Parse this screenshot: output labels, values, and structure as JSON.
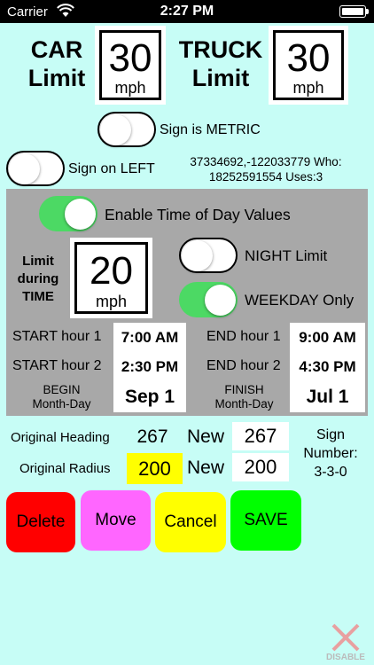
{
  "status_bar": {
    "carrier": "Carrier",
    "time": "2:27 PM"
  },
  "car": {
    "label_line1": "CAR",
    "label_line2": "Limit",
    "speed": "30",
    "unit": "mph"
  },
  "truck": {
    "label_line1": "TRUCK",
    "label_line2": "Limit",
    "speed": "30",
    "unit": "mph"
  },
  "toggles": {
    "metric": {
      "label": "Sign is METRIC",
      "on": false
    },
    "left": {
      "label": "Sign on LEFT",
      "on": false
    },
    "time_of_day": {
      "label": "Enable Time of Day Values",
      "on": true
    },
    "night": {
      "label": "NIGHT Limit",
      "on": false
    },
    "weekday": {
      "label": "WEEKDAY Only",
      "on": true
    }
  },
  "info": {
    "line1": "37334692,-122033779 Who:",
    "line2": "18252591554 Uses:3"
  },
  "time_limit": {
    "label_line1": "Limit",
    "label_line2": "during",
    "label_line3": "TIME",
    "speed": "20",
    "unit": "mph"
  },
  "schedule": {
    "start1_label": "START hour 1",
    "start1_value": "7:00 AM",
    "start2_label": "START hour 2",
    "start2_value": "2:30 PM",
    "end1_label": "END hour 1",
    "end1_value": "9:00 AM",
    "end2_label": "END hour 2",
    "end2_value": "4:30 PM",
    "begin_label_line1": "BEGIN",
    "begin_label_line2": "Month-Day",
    "begin_value": "Sep 1",
    "finish_label_line1": "FINISH",
    "finish_label_line2": "Month-Day",
    "finish_value": "Jul 1"
  },
  "heading": {
    "label": "Original Heading",
    "original": "267",
    "new_label": "New",
    "new_value": "267"
  },
  "radius": {
    "label": "Original Radius",
    "original": "200",
    "new_label": "New",
    "new_value": "200"
  },
  "sign_number": {
    "line1": "Sign",
    "line2": "Number:",
    "line3": "3-3-0"
  },
  "buttons": {
    "delete": "Delete",
    "move": "Move",
    "cancel": "Cancel",
    "save": "SAVE"
  },
  "disable": {
    "label": "DISABLE"
  },
  "colors": {
    "background": "#c7fdf6",
    "panel": "#a8a8a8",
    "toggle_on": "#4cd964",
    "delete": "#ff0000",
    "move": "#ff66ff",
    "cancel": "#ffff00",
    "save": "#00ff00",
    "radius_highlight": "#ffff00",
    "disable_icon": "#e8a0a0"
  }
}
